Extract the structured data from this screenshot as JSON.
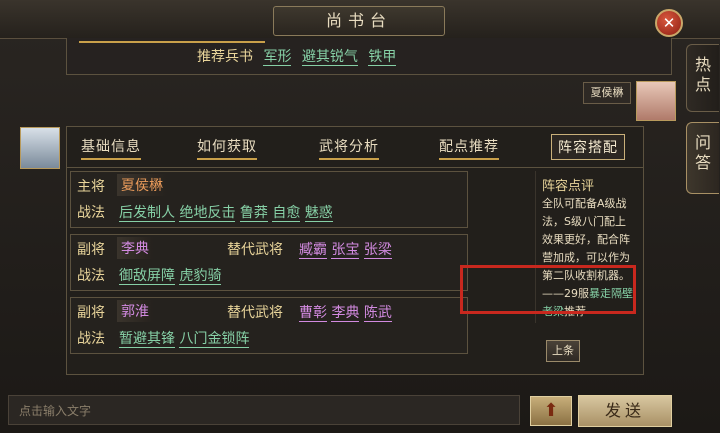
{
  "window": {
    "title": "尚书台",
    "close_icon": "close-icon"
  },
  "side_tabs": [
    {
      "label": "热\n点"
    },
    {
      "label": "问\n答"
    }
  ],
  "top_box": {
    "label": "推荐兵书",
    "books": [
      "军形",
      "避其锐气",
      "铁甲"
    ]
  },
  "user": {
    "name": "夏侯楙"
  },
  "tabs": [
    "基础信息",
    "如何获取",
    "武将分析",
    "配点推荐",
    "阵容搭配"
  ],
  "active_tab": "阵容搭配",
  "lineup": {
    "main": {
      "role": "主将",
      "name": "夏侯楙",
      "tactic_label": "战法",
      "tactics": [
        "后发制人",
        "绝地反击",
        "鲁莽",
        "自愈",
        "魅惑"
      ]
    },
    "vice1": {
      "role": "副将",
      "name": "李典",
      "alt_label": "替代武将",
      "alts": [
        "臧霸",
        "张宝",
        "张梁"
      ],
      "tactic_label": "战法",
      "tactics": [
        "御敌屏障",
        "虎豹骑"
      ]
    },
    "vice2": {
      "role": "副将",
      "name": "郭淮",
      "alt_label": "替代武将",
      "alts": [
        "曹彰",
        "李典",
        "陈武"
      ],
      "tactic_label": "战法",
      "tactics": [
        "暂避其锋",
        "八门金锁阵"
      ]
    }
  },
  "review": {
    "title": "阵容点评",
    "text": "全队可配备A级战法，S级八门配上效果更好，配合阵营加成，可以作为第二队收割机器。",
    "credit_prefix": "——29服",
    "author": "暴走隔壁老梁",
    "credit_suffix": "推荐"
  },
  "prev_button": "上条",
  "input": {
    "placeholder": "点击输入文字"
  },
  "send_button": "发送"
}
